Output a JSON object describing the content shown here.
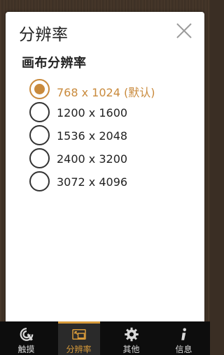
{
  "dialog": {
    "title": "分辨率",
    "section_title": "画布分辨率",
    "options": [
      {
        "label": "768 x 1024 (默认)",
        "selected": true
      },
      {
        "label": "1200 x 1600",
        "selected": false
      },
      {
        "label": "1536 x 2048",
        "selected": false
      },
      {
        "label": "2400 x 3200",
        "selected": false
      },
      {
        "label": "3072 x 4096",
        "selected": false
      }
    ]
  },
  "tabbar": {
    "tabs": [
      {
        "label": "触摸",
        "icon": "touch-icon",
        "active": false
      },
      {
        "label": "分辨率",
        "icon": "resolution-icon",
        "active": true
      },
      {
        "label": "其他",
        "icon": "gear-icon",
        "active": false
      },
      {
        "label": "信息",
        "icon": "info-icon",
        "active": false
      }
    ]
  },
  "colors": {
    "accent": "#c98a3c",
    "tab_accent": "#d79a3a",
    "tabbar_bg": "#0d0d0d"
  }
}
